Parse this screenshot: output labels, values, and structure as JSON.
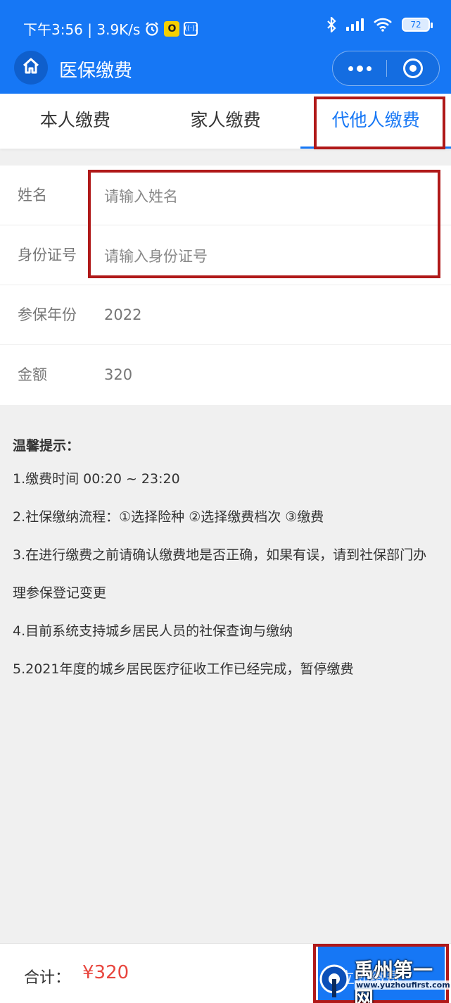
{
  "status_bar": {
    "time_speed": "下午3:56 | 3.9K/s",
    "battery": "72"
  },
  "nav": {
    "title": "医保缴费"
  },
  "tabs": [
    {
      "label": "本人缴费",
      "active": false
    },
    {
      "label": "家人缴费",
      "active": false
    },
    {
      "label": "代他人缴费",
      "active": true
    }
  ],
  "form": {
    "name": {
      "label": "姓名",
      "placeholder": "请输入姓名"
    },
    "id_number": {
      "label": "身份证号",
      "placeholder": "请输入身份证号"
    },
    "year": {
      "label": "参保年份",
      "value": "2022"
    },
    "amount": {
      "label": "金额",
      "value": "320"
    }
  },
  "tips": {
    "title": "温馨提示：",
    "items": [
      "1.缴费时间 00:20 ~ 23:20",
      "2.社保缴纳流程：①选择险种 ②选择缴费档次 ③缴费",
      "3.在进行缴费之前请确认缴费地是否正确，如果有误，请到社保部门办理参保登记变更",
      "4.目前系统支持城乡居民人员的社保查询与缴纳",
      "5.2021年度的城乡居民医疗征收工作已经完成，暂停缴费"
    ]
  },
  "footer": {
    "total_label": "合计：",
    "total_value": "¥320",
    "pay_label": "立即缴费"
  },
  "watermark": {
    "text": "禹州第一网",
    "url": "www.yuzhoufirst.com"
  },
  "colors": {
    "primary": "#1677f5",
    "price": "#e8463e",
    "highlight_box": "#b01919"
  }
}
